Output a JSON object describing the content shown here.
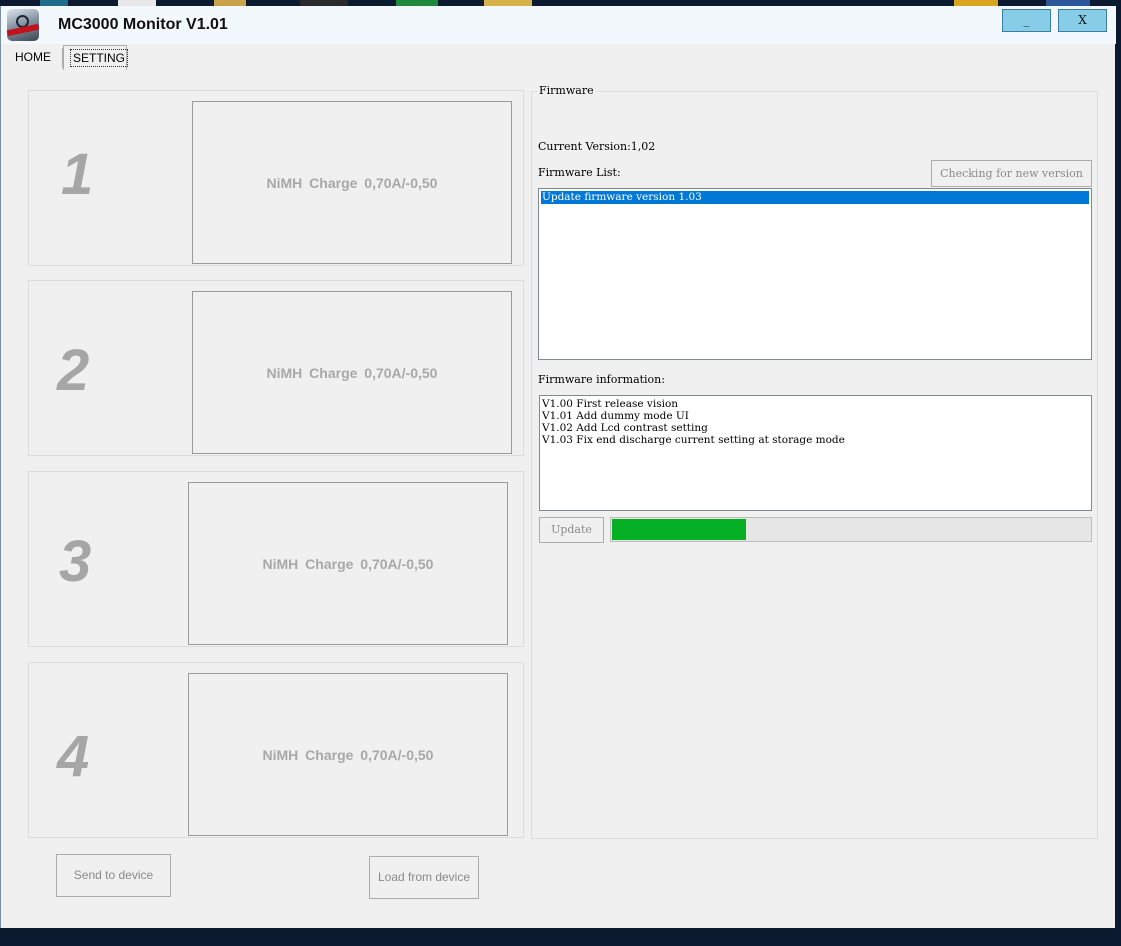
{
  "window": {
    "title": "MC3000 Monitor V1.01",
    "minimize_label": "_",
    "close_label": "X"
  },
  "tabs": [
    {
      "label": "HOME",
      "active": false
    },
    {
      "label": "SETTING",
      "active": true
    }
  ],
  "slots": [
    {
      "number": "1",
      "program": "NiMH  Charge  0,70A/-0,50"
    },
    {
      "number": "2",
      "program": "NiMH  Charge  0,70A/-0,50"
    },
    {
      "number": "3",
      "program": "NiMH  Charge  0,70A/-0,50"
    },
    {
      "number": "4",
      "program": "NiMH  Charge  0,70A/-0,50"
    }
  ],
  "buttons": {
    "send": "Send to device",
    "load": "Load from device"
  },
  "firmware": {
    "group_title": "Firmware",
    "current_version_label": "Current Version:1,02",
    "list_label": "Firmware List:",
    "check_button": "Checking for new version",
    "list_items": [
      "Update firmware version 1.03"
    ],
    "info_label": "Firmware information:",
    "info_lines": [
      "V1.00 First release vision",
      "V1.01 Add dummy mode UI",
      "V1.02 Add Lcd contrast setting",
      "V1.03 Fix end discharge current setting at storage mode"
    ],
    "update_button": "Update",
    "progress": 0.28
  },
  "colors": {
    "progress_fill": "#06b025",
    "selection": "#0078d7",
    "window_button": "#87cde8"
  }
}
